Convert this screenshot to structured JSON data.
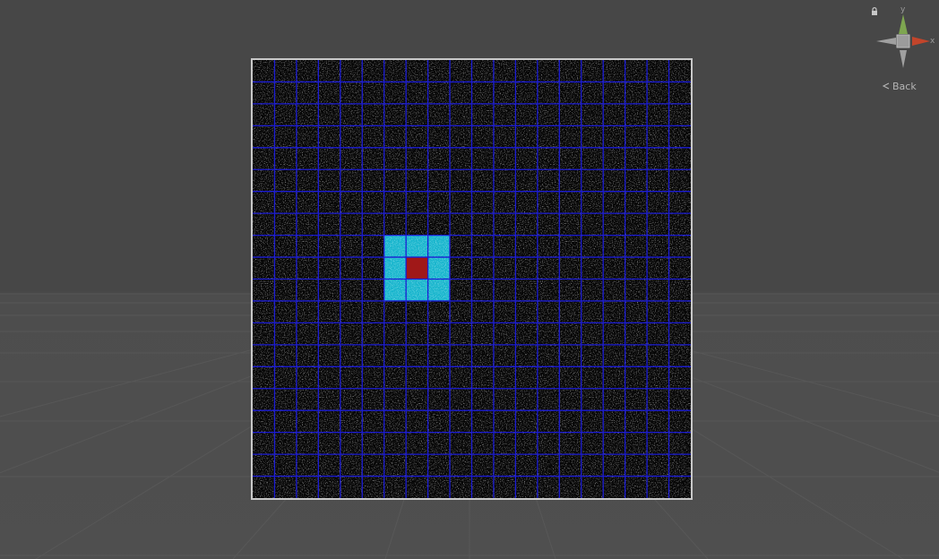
{
  "scene": {
    "view_label": "Back",
    "axis_y": "y",
    "axis_x": "x",
    "icons": {
      "lock": "lock-icon",
      "view_arrow": "back-arrow-icon",
      "gizmo": "orientation-gizmo-icon"
    }
  },
  "board": {
    "columns": 20,
    "rows": 20,
    "selected_center": {
      "col": 7,
      "row": 9
    },
    "neighborhood": {
      "col_from": 6,
      "col_to": 8,
      "row_from": 8,
      "row_to": 10
    },
    "colors": {
      "background": "#050505",
      "noise": "#5a5a5a",
      "grid_line": "#1c1cd4",
      "neighbor_cell": "#15b4cc",
      "center_cell": "#a01818",
      "border": "#c8c8c8"
    }
  },
  "gizmo": {
    "colors": {
      "y_axis": "#7ea650",
      "x_axis": "#c2452b",
      "neutral": "#a0a0a0",
      "center": "#9c9c9c"
    }
  }
}
